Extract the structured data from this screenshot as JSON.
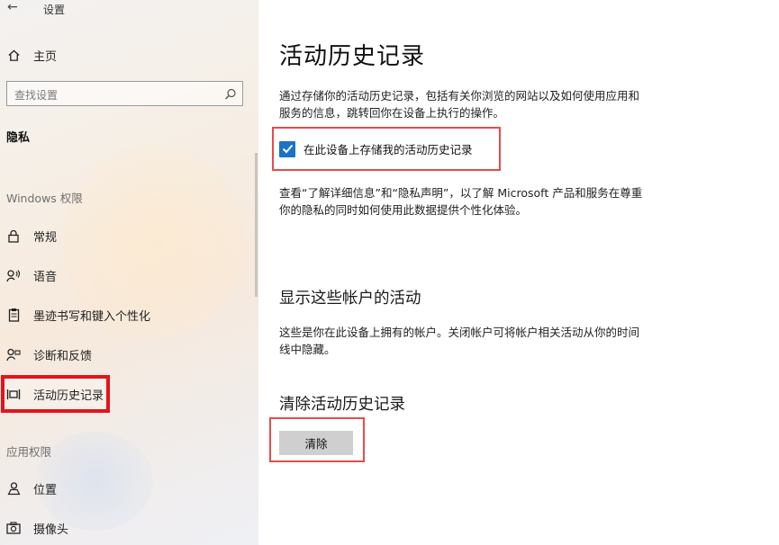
{
  "window": {
    "title": "设置"
  },
  "sidebar": {
    "home_label": "主页",
    "search_placeholder": "查找设置",
    "category": "隐私",
    "section_windows": "Windows 权限",
    "section_app": "应用权限",
    "items": [
      {
        "label": "常规",
        "icon": "lock-icon"
      },
      {
        "label": "语音",
        "icon": "speech-icon"
      },
      {
        "label": "墨迹书写和键入个性化",
        "icon": "clipboard-icon"
      },
      {
        "label": "诊断和反馈",
        "icon": "feedback-icon"
      },
      {
        "label": "活动历史记录",
        "icon": "timeline-icon",
        "selected": true
      },
      {
        "label": "位置",
        "icon": "location-icon"
      },
      {
        "label": "摄像头",
        "icon": "camera-icon"
      }
    ]
  },
  "main": {
    "title": "活动历史记录",
    "intro_line1": "通过存储你的活动历史记录，包括有关你浏览的网站以及如何使用应用和",
    "intro_line2": "服务的信息，跳转回你在设备上执行的操作。",
    "store_checkbox_label": "在此设备上存储我的活动历史记录",
    "store_checkbox_checked": true,
    "learn_line1": "查看“了解详细信息”和“隐私声明”，以了解 Microsoft 产品和服务在尊重",
    "learn_line2": "你的隐私的同时如何使用此数据提供个性化体验。",
    "accounts_heading": "显示这些帐户的活动",
    "accounts_line1": "这些是你在此设备上拥有的帐户。关闭帐户可将帐户相关活动从你的时间",
    "accounts_line2": "线中隐藏。",
    "clear_heading": "清除活动历史记录",
    "clear_button": "清除"
  },
  "colors": {
    "accent": "#1a73c8",
    "highlight_red": "#e6121b",
    "button_gray": "#cfcfcf"
  }
}
